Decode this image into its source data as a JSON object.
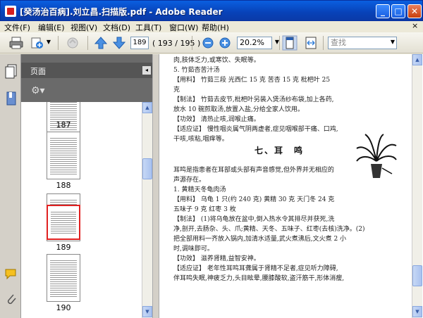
{
  "window": {
    "title": "[癸汤治百病].刘立昌.扫描版.pdf - Adobe Reader",
    "min": "_",
    "max": "□",
    "close": "✕"
  },
  "menu": [
    {
      "label": "文件(F)"
    },
    {
      "label": "编辑(E)"
    },
    {
      "label": "视图(V)"
    },
    {
      "label": "文档(D)"
    },
    {
      "label": "工具(T)"
    },
    {
      "label": "窗口(W)"
    },
    {
      "label": "帮助(H)"
    }
  ],
  "menu_close": "×",
  "toolbar": {
    "current_page": "189",
    "page_total": "( 193 / 195 )",
    "zoom": "20.2%",
    "search_placeholder": "查找"
  },
  "panel": {
    "title": "页面",
    "close": "◂",
    "options": "⚙▾",
    "thumbnails": [
      {
        "label": "187",
        "selected": false
      },
      {
        "label": "188",
        "selected": false
      },
      {
        "label": "189",
        "selected": true
      },
      {
        "label": "190",
        "selected": false
      }
    ]
  },
  "document": {
    "lines_top": [
      "肉,肢体乏力,或寒饮、失眠等。",
      "   5. 竹茹杏苦汁汤",
      "   【用料】 竹茹三段  光西仁 15 克  苦杏 15 克  枇杷叶 25",
      "克",
      "   【制法】 竹茹去皮节,枇杷叶另装入煲汤纱布袋,加上各药,",
      "放水 10 碗煎取汤,放置入盐,分给全家人饮用。",
      "   【功效】 清热止咳,润喉止痛。",
      "   【适应证】 慢性咽炎属气阴两虚者,症见咽喉部干痛、口鸡,",
      "干咳,咳粘,咽痒等。"
    ],
    "heading": "七、耳　鸣",
    "lines_bottom": [
      "   耳鸣是指患者在耳部或头部有声音感觉,但外界并无相应的",
      "声源存在。",
      "   1. 黄精天冬龟肉汤",
      "   【用料】 乌龟 1 只(约 240 克)  黄精 30 克  天门冬 24 克",
      "五味子 9 克  红枣 3 枚",
      "   【制法】 (1)将乌龟放在盆中,倒入热水令其排尽并获死,洗",
      "净,剖开,去肠杂、头、爪;黄精、天冬、五味子、红枣(去核)洗净。(2)",
      "把全部用料一齐放入锅内,加清水适量,武火煮沸后,文火煮 2 小",
      "时,调味即可。",
      "   【功效】 滋养肾精,益智安神。",
      "   【适应证】 老年性耳鸣耳聋属于肾精不足者,症见听力障碍,",
      "伴耳鸣失眠,神疲乏力,头目眩晕,腰膝酸软,盗汗筋干,形体消瘦,"
    ]
  },
  "colors": {
    "titlebar": "#0842b8",
    "panel_bg": "#6a6a6a",
    "selected_thumb": "#e02020"
  }
}
